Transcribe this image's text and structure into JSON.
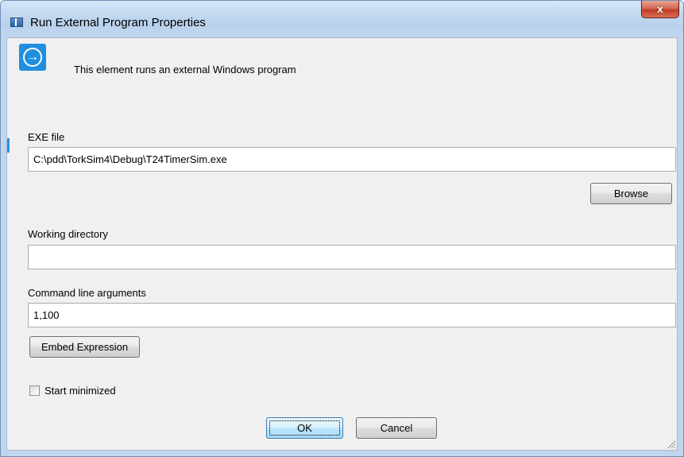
{
  "window": {
    "title": "Run External Program Properties",
    "close_label": "x"
  },
  "header": {
    "icon": "circle-arrow-right-icon",
    "description": "This element runs an external Windows program"
  },
  "form": {
    "exe_label": "EXE file",
    "exe_value": "C:\\pdd\\TorkSim4\\Debug\\T24TimerSim.exe",
    "browse_label": "Browse",
    "workdir_label": "Working directory",
    "workdir_value": "",
    "args_label": "Command line arguments",
    "args_value": "1,100",
    "embed_label": "Embed Expression",
    "start_minimized_label": "Start minimized",
    "start_minimized_checked": false
  },
  "footer": {
    "ok_label": "OK",
    "cancel_label": "Cancel"
  },
  "colors": {
    "accent": "#1f8fe0",
    "close_red": "#c23b22",
    "dialog_bg": "#f0f0f0"
  }
}
